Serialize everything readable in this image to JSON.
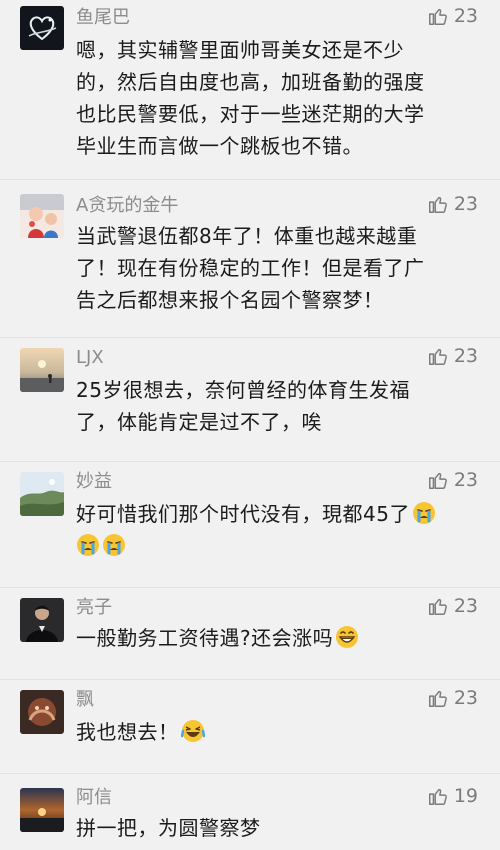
{
  "comments": [
    {
      "name": "鱼尾巴",
      "likes": "23",
      "lines": [
        "嗯，其实辅警里面帅哥美女还是不少",
        "的，然后自由度也高，加班备勤的强度",
        "也比民警要低，对于一些迷茫期的大学",
        "毕业生而言做一个跳板也不错。"
      ]
    },
    {
      "name": "A贪玩的金牛",
      "likes": "23",
      "lines": [
        "当武警退伍都8年了！体重也越来越重",
        "了！现在有份稳定的工作！但是看了广",
        "告之后都想来报个名园个警察梦！"
      ]
    },
    {
      "name": "LJX",
      "likes": "23",
      "lines": [
        "25岁很想去，奈何曾经的体育生发福",
        "了，体能肯定是过不了，唉"
      ]
    },
    {
      "name": "妙益",
      "likes": "23",
      "lines": [
        "好可惜我们那个时代没有，現都45了"
      ]
    },
    {
      "name": "亮子",
      "likes": "23",
      "lines": [
        "一般勤务工资待遇?还会涨吗"
      ]
    },
    {
      "name": "飘",
      "likes": "23",
      "lines": [
        "我也想去！"
      ]
    },
    {
      "name": "阿信",
      "likes": "19",
      "lines": [
        "拼一把，为圆警察梦"
      ]
    }
  ],
  "icons": {
    "like": "thumbs-up-outline-icon",
    "emoji_cry": "crying-face-emoji",
    "emoji_grin": "grinning-face-emoji",
    "emoji_laugh_cry": "laughing-tears-emoji"
  },
  "colors": {
    "background": "#f1f1f1",
    "name": "#8c8c8c",
    "text": "#1b1b1b",
    "like": "#7b7b7b"
  }
}
